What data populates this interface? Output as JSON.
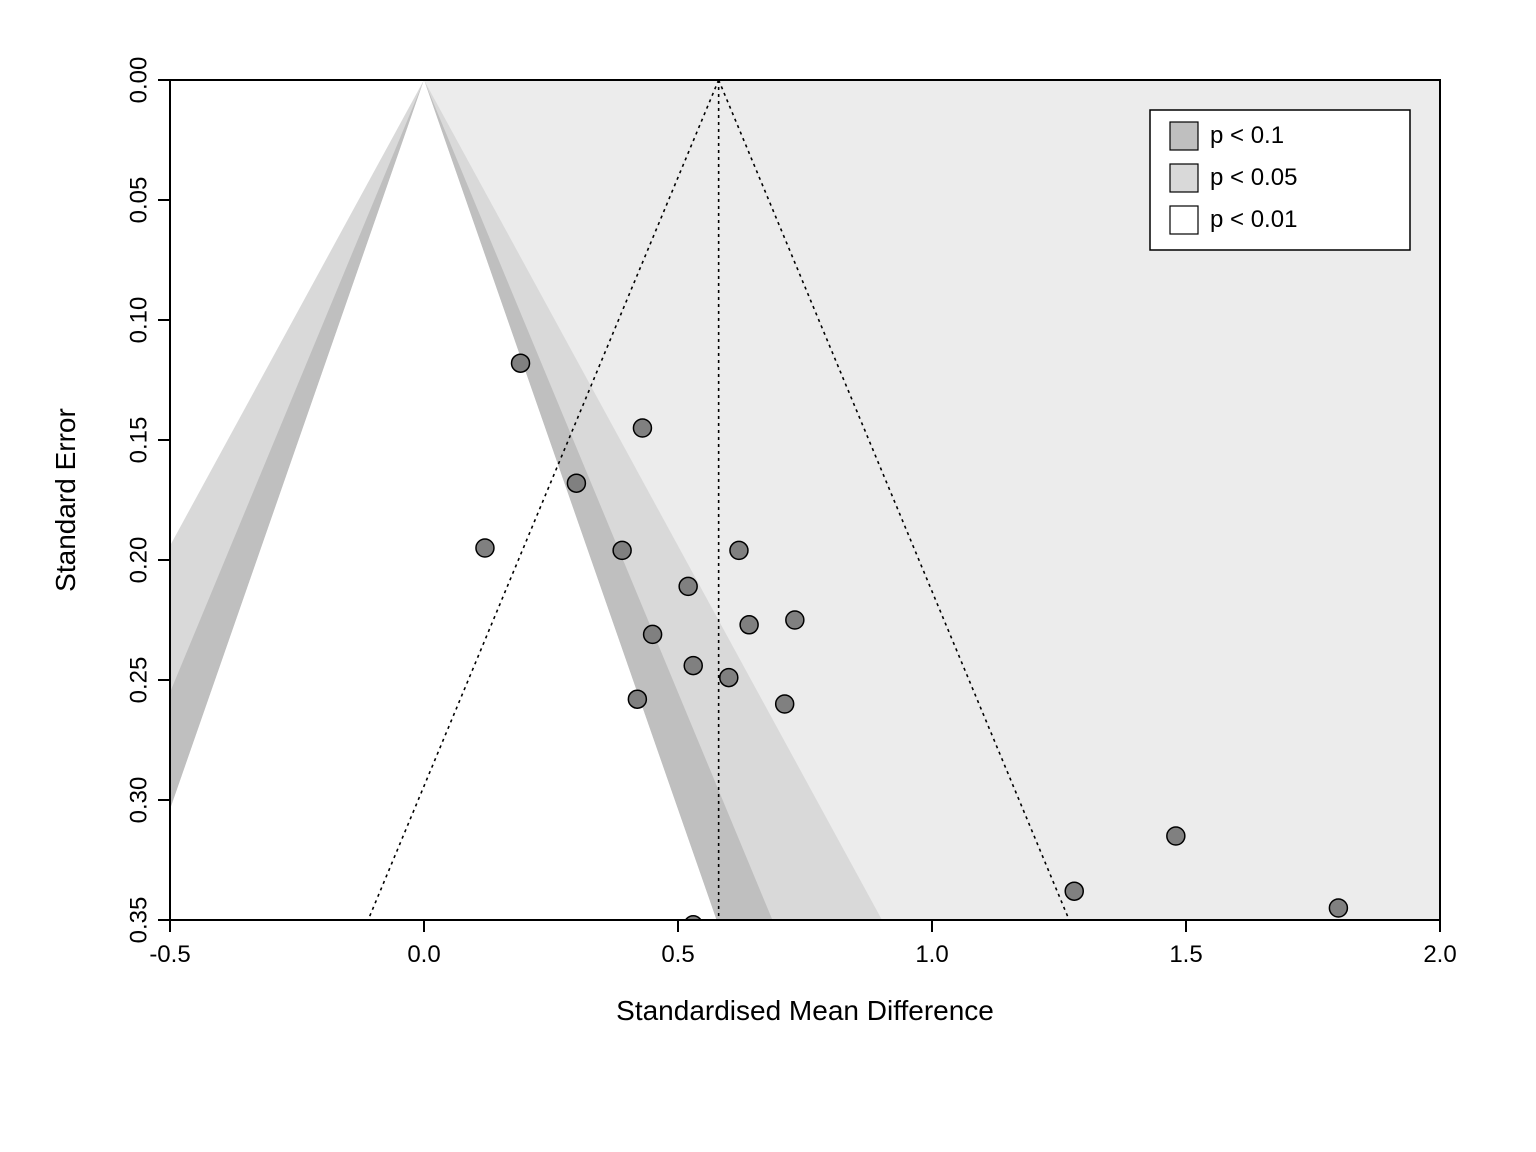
{
  "chart_data": {
    "type": "scatter",
    "title": "",
    "xlabel": "Standardised Mean Difference",
    "ylabel": "Standard Error",
    "xlim": [
      -0.5,
      2.0
    ],
    "ylim": [
      0.35,
      0.0
    ],
    "x_ticks": [
      -0.5,
      0.0,
      0.5,
      1.0,
      1.5,
      2.0
    ],
    "y_ticks": [
      0.0,
      0.05,
      0.1,
      0.15,
      0.2,
      0.25,
      0.3,
      0.35
    ],
    "x_tick_labels": [
      "-0.5",
      "0.0",
      "0.5",
      "1.0",
      "1.5",
      "2.0"
    ],
    "y_tick_labels": [
      "0.00",
      "0.05",
      "0.10",
      "0.15",
      "0.20",
      "0.25",
      "0.30",
      "0.35"
    ],
    "funnel": {
      "apex_x": 0.58,
      "left_bottom_x": -0.11,
      "right_bottom_x": 1.27,
      "bottom_se": 0.35
    },
    "contours": {
      "apex_x": 0.0,
      "p10_z": 1.645,
      "p05_z": 1.96,
      "p01_z": 2.576
    },
    "points": [
      {
        "x": 0.19,
        "se": 0.118
      },
      {
        "x": 0.43,
        "se": 0.145
      },
      {
        "x": 0.3,
        "se": 0.168
      },
      {
        "x": 0.12,
        "se": 0.195
      },
      {
        "x": 0.39,
        "se": 0.196
      },
      {
        "x": 0.62,
        "se": 0.196
      },
      {
        "x": 0.52,
        "se": 0.211
      },
      {
        "x": 0.73,
        "se": 0.225
      },
      {
        "x": 0.64,
        "se": 0.227
      },
      {
        "x": 0.45,
        "se": 0.231
      },
      {
        "x": 0.53,
        "se": 0.244
      },
      {
        "x": 0.6,
        "se": 0.249
      },
      {
        "x": 0.42,
        "se": 0.258
      },
      {
        "x": 0.71,
        "se": 0.26
      },
      {
        "x": 1.48,
        "se": 0.315
      },
      {
        "x": 1.28,
        "se": 0.338
      },
      {
        "x": 1.8,
        "se": 0.345
      },
      {
        "x": 0.53,
        "se": 0.352
      }
    ],
    "legend": [
      {
        "label": "p < 0.1",
        "fill": "#bfbfbf"
      },
      {
        "label": "p < 0.05",
        "fill": "#d9d9d9"
      },
      {
        "label": "p < 0.01",
        "fill": "#ffffff"
      }
    ],
    "colors": {
      "bg_light": "#ececec",
      "mid": "#d9d9d9",
      "dark": "#bfbfbf",
      "point_fill": "#808080",
      "point_stroke": "#000000"
    }
  }
}
